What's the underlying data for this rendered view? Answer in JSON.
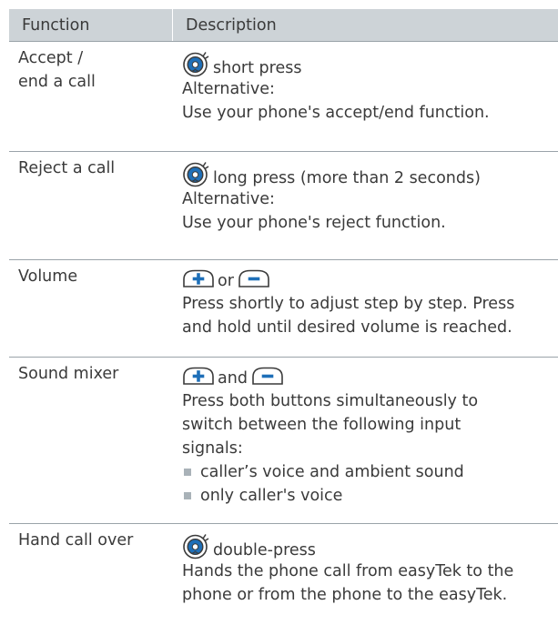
{
  "header": {
    "function": "Function",
    "description": "Description"
  },
  "rows": [
    {
      "function_lines": [
        "Accept /",
        "end a call"
      ],
      "first_line": "short press",
      "lines": [
        "Alternative:",
        "Use your phone's accept/end function."
      ]
    },
    {
      "function_lines": [
        "Reject a call"
      ],
      "first_line": "long press (more than 2 seconds)",
      "lines": [
        "Alternative:",
        "Use your phone's reject function."
      ]
    },
    {
      "function_lines": [
        "Volume"
      ],
      "connector": "or",
      "lines": [
        "Press shortly to adjust step by step. Press",
        "and hold until desired volume is reached."
      ]
    },
    {
      "function_lines": [
        "Sound mixer"
      ],
      "connector": "and",
      "lines": [
        "Press both buttons simultaneously to",
        "switch between the following input",
        "signals:"
      ],
      "bullets": [
        "caller’s voice and ambient sound",
        "only caller's voice"
      ]
    },
    {
      "function_lines": [
        "Hand call over"
      ],
      "first_line": "double-press",
      "lines": [
        "Hands the phone call from easyTek to the",
        "phone or from the phone to the easyTek."
      ]
    }
  ],
  "icons": {
    "multifunction": "multifunction-button-icon",
    "plus": "plus-button-icon",
    "minus": "minus-button-icon"
  },
  "colors": {
    "accent_blue": "#1e6fb8",
    "header_bg": "#cdd3d7",
    "rule": "#9aa3a9",
    "bullet": "#a9b2b8"
  }
}
